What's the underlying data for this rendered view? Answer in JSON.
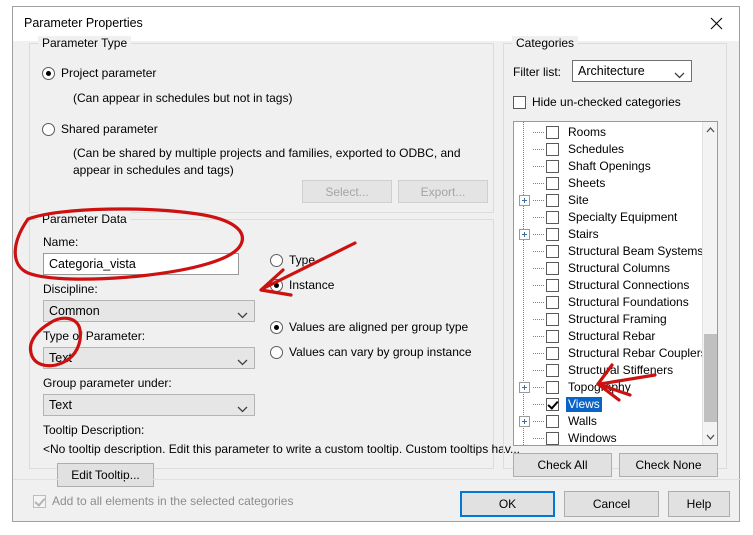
{
  "window": {
    "title": "Parameter Properties",
    "close_icon": "close-icon"
  },
  "parameter_type": {
    "legend": "Parameter Type",
    "project": {
      "label": "Project parameter",
      "hint": "(Can appear in schedules but not in tags)",
      "selected": true
    },
    "shared": {
      "label": "Shared parameter",
      "hint_line1": "(Can be shared by multiple projects and families, exported to ODBC, and",
      "hint_line2": "appear in schedules and tags)",
      "selected": false
    },
    "select_button": "Select...",
    "export_button": "Export..."
  },
  "parameter_data": {
    "legend": "Parameter Data",
    "name_label": "Name:",
    "name_value": "Categoria_vista",
    "name_placeholder": "",
    "discipline_label": "Discipline:",
    "discipline_value": "Common",
    "type_of_parameter_label": "Type of Parameter:",
    "type_of_parameter_value": "Text",
    "group_under_label": "Group parameter under:",
    "group_under_value": "Text",
    "tooltip_label": "Tooltip Description:",
    "tooltip_value": "<No tooltip description. Edit this parameter to write a custom tooltip. Custom tooltips hav...",
    "edit_tooltip_button": "Edit Tooltip...",
    "type_radio": "Type",
    "instance_radio": "Instance",
    "type_selected": false,
    "instance_selected": true,
    "values_aligned_radio": "Values are aligned per group type",
    "values_vary_radio": "Values can vary by group instance",
    "values_aligned_selected": true,
    "values_vary_selected": false
  },
  "categories": {
    "legend": "Categories",
    "filter_label": "Filter list:",
    "filter_value": "Architecture",
    "hide_unchecked_label": "Hide un-checked categories",
    "hide_unchecked_checked": false,
    "check_all_button": "Check All",
    "check_none_button": "Check None",
    "items": [
      {
        "label": "Rooms",
        "checked": false,
        "expandable": false,
        "selected": false
      },
      {
        "label": "Schedules",
        "checked": false,
        "expandable": false,
        "selected": false
      },
      {
        "label": "Shaft Openings",
        "checked": false,
        "expandable": false,
        "selected": false
      },
      {
        "label": "Sheets",
        "checked": false,
        "expandable": false,
        "selected": false
      },
      {
        "label": "Site",
        "checked": false,
        "expandable": true,
        "selected": false
      },
      {
        "label": "Specialty Equipment",
        "checked": false,
        "expandable": false,
        "selected": false
      },
      {
        "label": "Stairs",
        "checked": false,
        "expandable": true,
        "selected": false
      },
      {
        "label": "Structural Beam Systems",
        "checked": false,
        "expandable": false,
        "selected": false
      },
      {
        "label": "Structural Columns",
        "checked": false,
        "expandable": false,
        "selected": false
      },
      {
        "label": "Structural Connections",
        "checked": false,
        "expandable": false,
        "selected": false
      },
      {
        "label": "Structural Foundations",
        "checked": false,
        "expandable": false,
        "selected": false
      },
      {
        "label": "Structural Framing",
        "checked": false,
        "expandable": false,
        "selected": false
      },
      {
        "label": "Structural Rebar",
        "checked": false,
        "expandable": false,
        "selected": false
      },
      {
        "label": "Structural Rebar Couplers",
        "checked": false,
        "expandable": false,
        "selected": false
      },
      {
        "label": "Structural Stiffeners",
        "checked": false,
        "expandable": false,
        "selected": false
      },
      {
        "label": "Topography",
        "checked": false,
        "expandable": true,
        "selected": false
      },
      {
        "label": "Views",
        "checked": true,
        "expandable": false,
        "selected": true
      },
      {
        "label": "Walls",
        "checked": false,
        "expandable": true,
        "selected": false
      },
      {
        "label": "Windows",
        "checked": false,
        "expandable": false,
        "selected": false
      }
    ]
  },
  "footer": {
    "add_all_label": "Add to all elements in the selected categories",
    "add_all_checked": true,
    "add_all_disabled": true,
    "ok_button": "OK",
    "cancel_button": "Cancel",
    "help_button": "Help"
  },
  "annotations": {
    "color": "#cc1111",
    "marks": [
      {
        "name": "name-field-circle",
        "shape": "ellipse"
      },
      {
        "name": "type-of-parameter-circle",
        "shape": "ellipse"
      },
      {
        "name": "instance-radio-arrow",
        "shape": "arrow"
      },
      {
        "name": "views-category-arrow",
        "shape": "arrow"
      }
    ]
  },
  "colors": {
    "accent": "#0078d7",
    "selection": "#0a64c8",
    "dialog_bg": "#f0f0f0",
    "annotation_red": "#cc1111"
  }
}
